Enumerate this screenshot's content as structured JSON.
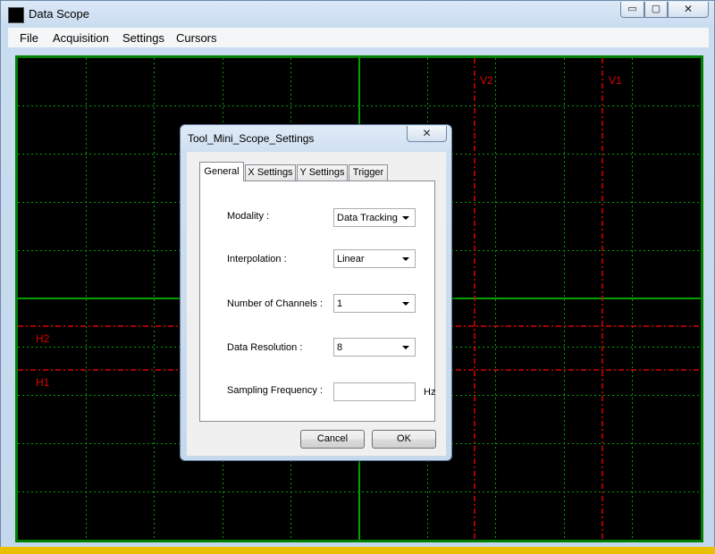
{
  "window": {
    "title": "Data Scope",
    "minimize_glyph": "▭",
    "maximize_glyph": "▢",
    "close_glyph": "✕"
  },
  "menu": [
    "File",
    "Acquisition",
    "Settings",
    "Cursors"
  ],
  "scope": {
    "background": "#000000",
    "grid_color": "#00a000",
    "axis_color": "#00a000",
    "cursor_color": "#e00000",
    "cursors": {
      "vertical": [
        {
          "label": "V2"
        },
        {
          "label": "V1"
        }
      ],
      "horizontal": [
        {
          "label": "H2"
        },
        {
          "label": "H1"
        }
      ]
    }
  },
  "dialog": {
    "title": "Tool_Mini_Scope_Settings",
    "close_glyph": "✕",
    "tabs": [
      "General",
      "X Settings",
      "Y Settings",
      "Trigger"
    ],
    "active_tab": "General",
    "fields": {
      "modality": {
        "label": "Modality :",
        "value": "Data Tracking"
      },
      "interpolation": {
        "label": "Interpolation :",
        "value": "Linear"
      },
      "channels": {
        "label": "Number of Channels :",
        "value": "1"
      },
      "resolution": {
        "label": "Data Resolution :",
        "value": "8"
      },
      "sampling": {
        "label": "Sampling Frequency :",
        "value": "",
        "unit": "Hz"
      }
    },
    "buttons": {
      "cancel": "Cancel",
      "ok": "OK"
    }
  }
}
